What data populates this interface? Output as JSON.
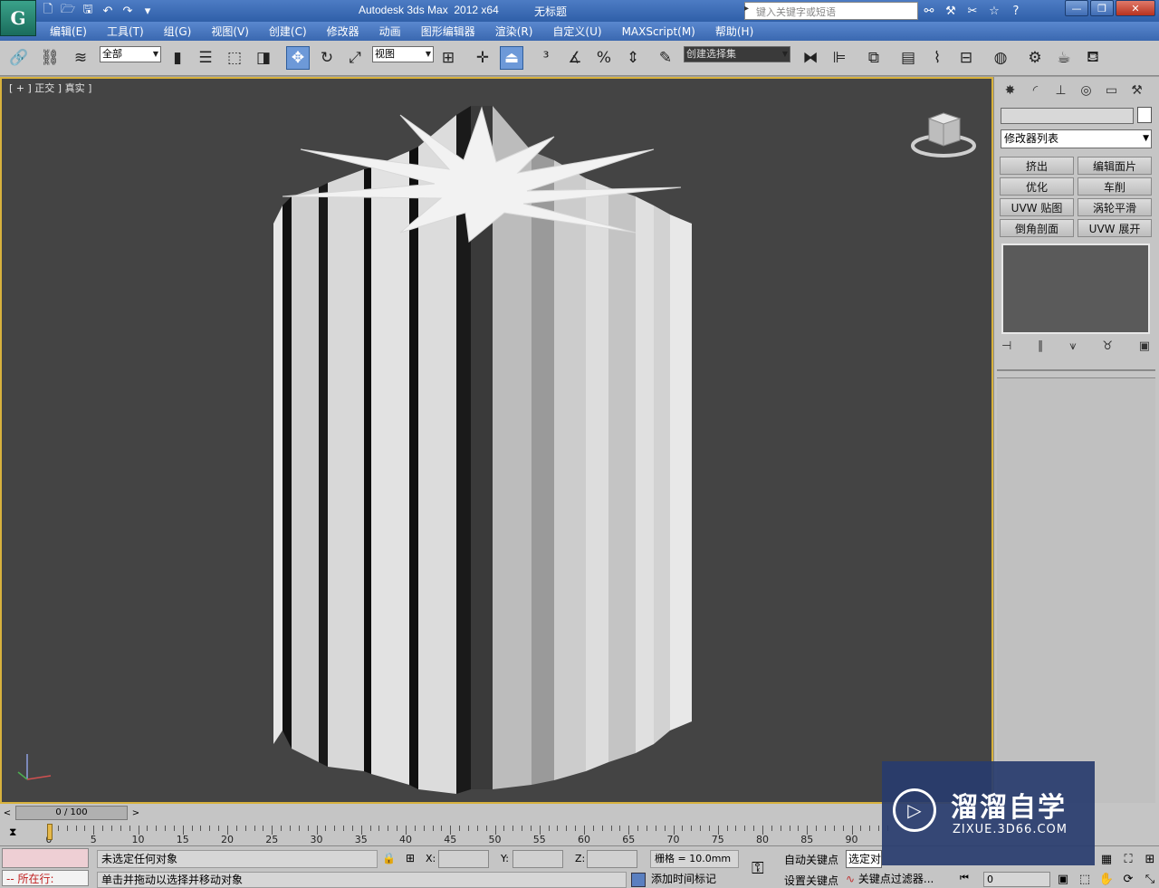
{
  "window": {
    "app_title": "Autodesk 3ds Max  2012 x64",
    "doc_title": "无标题",
    "search_placeholder": "键入关键字或短语",
    "app_icon_glyph": "G"
  },
  "menu": [
    "编辑(E)",
    "工具(T)",
    "组(G)",
    "视图(V)",
    "创建(C)",
    "修改器",
    "动画",
    "图形编辑器",
    "渲染(R)",
    "自定义(U)",
    "MAXScript(M)",
    "帮助(H)"
  ],
  "toolbar": {
    "selection_filter": "全部",
    "ref_coord": "视图",
    "named_selection": "创建选择集"
  },
  "viewport": {
    "label": "[ + ] 正交 ] 真实 ]",
    "background": "#444444",
    "border_color": "#d8b23d"
  },
  "command_panel": {
    "modifier_list": "修改器列表",
    "buttons": [
      "挤出",
      "编辑面片",
      "优化",
      "车削",
      "UVW 贴图",
      "涡轮平滑",
      "倒角剖面",
      "UVW 展开"
    ]
  },
  "timeline": {
    "slider_text": "0 / 100",
    "ticks": [
      "0",
      "5",
      "10",
      "15",
      "20",
      "25",
      "30",
      "35",
      "40",
      "45",
      "50",
      "55",
      "60",
      "65",
      "70",
      "75",
      "80",
      "85",
      "90"
    ]
  },
  "status": {
    "running": "-- 所在行:",
    "message": "未选定任何对象",
    "prompt": "单击并拖动以选择并移动对象",
    "x_label": "X:",
    "y_label": "Y:",
    "z_label": "Z:",
    "grid": "栅格 = 10.0mm",
    "add_time_tag": "添加时间标记",
    "auto_key": "自动关键点",
    "set_key": "设置关键点",
    "selected": "选定对",
    "key_filters": "关键点过滤器...",
    "frame": "0"
  },
  "watermark": {
    "title": "溜溜自学",
    "subtitle": "ZIXUE.3D66.COM"
  }
}
